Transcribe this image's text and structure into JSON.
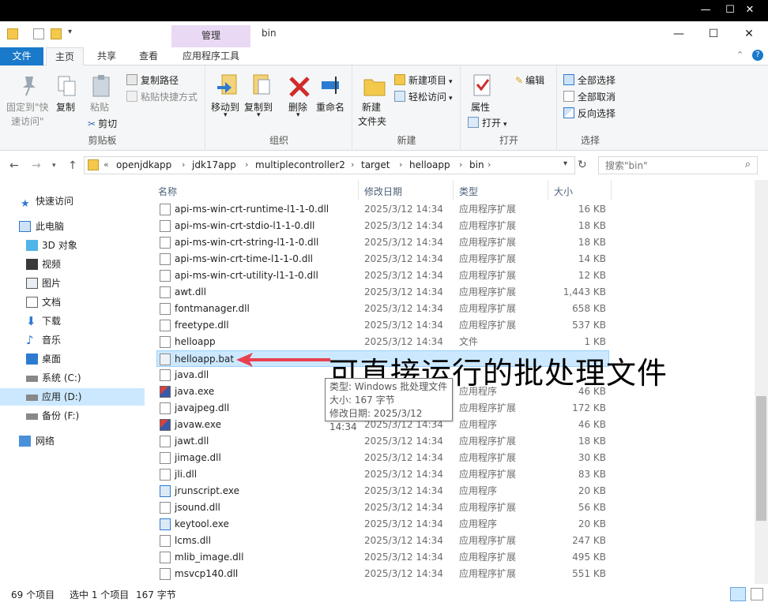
{
  "window": {
    "title": "bin",
    "contextual_group": "管理",
    "controls": {
      "minimize": "—",
      "maximize": "☐",
      "close": "✕"
    }
  },
  "tabs": {
    "file": "文件",
    "home": "主页",
    "share": "共享",
    "view": "查看",
    "app_tools": "应用程序工具"
  },
  "ribbon": {
    "clipboard": {
      "label": "剪贴板",
      "pin_l1": "固定到\"快",
      "pin_l2": "速访问\"",
      "copy": "复制",
      "paste": "粘贴",
      "copy_path": "复制路径",
      "paste_shortcut": "粘贴快捷方式",
      "cut": "剪切"
    },
    "organize": {
      "label": "组织",
      "move_to": "移动到",
      "copy_to": "复制到",
      "delete": "删除",
      "rename": "重命名"
    },
    "new": {
      "label": "新建",
      "new_folder_l1": "新建",
      "new_folder_l2": "文件夹",
      "new_item": "新建项目",
      "easy_access": "轻松访问"
    },
    "open": {
      "label": "打开",
      "properties": "属性",
      "open": "打开",
      "edit": "编辑"
    },
    "select": {
      "label": "选择",
      "select_all": "全部选择",
      "select_none": "全部取消",
      "invert": "反向选择"
    }
  },
  "address": {
    "crumbs": [
      "openjdkapp",
      "jdk17app",
      "multiplecontroller2",
      "target",
      "helloapp",
      "bin"
    ],
    "overflow": "«",
    "search_placeholder": "搜索\"bin\""
  },
  "nav": [
    {
      "label": "快速访问",
      "icon": "star-icon",
      "selected": false
    },
    {
      "label": "此电脑",
      "icon": "computer-icon",
      "selected": false
    },
    {
      "label": "3D 对象",
      "icon": "cube-icon",
      "selected": false
    },
    {
      "label": "视频",
      "icon": "video-icon",
      "selected": false
    },
    {
      "label": "图片",
      "icon": "picture-icon",
      "selected": false
    },
    {
      "label": "文档",
      "icon": "document-icon",
      "selected": false
    },
    {
      "label": "下载",
      "icon": "download-icon",
      "selected": false
    },
    {
      "label": "音乐",
      "icon": "music-icon",
      "selected": false
    },
    {
      "label": "桌面",
      "icon": "desktop-icon",
      "selected": false
    },
    {
      "label": "系统 (C:)",
      "icon": "drive-icon",
      "selected": false
    },
    {
      "label": "应用 (D:)",
      "icon": "drive-icon",
      "selected": true
    },
    {
      "label": "备份 (F:)",
      "icon": "drive-icon",
      "selected": false
    },
    {
      "label": "网络",
      "icon": "network-icon",
      "selected": false
    }
  ],
  "columns": {
    "name": "名称",
    "date": "修改日期",
    "type": "类型",
    "size": "大小"
  },
  "files": [
    {
      "name": "api-ms-win-crt-runtime-l1-1-0.dll",
      "date": "2025/3/12 14:34",
      "type": "应用程序扩展",
      "size": "16 KB",
      "icon": "dll"
    },
    {
      "name": "api-ms-win-crt-stdio-l1-1-0.dll",
      "date": "2025/3/12 14:34",
      "type": "应用程序扩展",
      "size": "18 KB",
      "icon": "dll"
    },
    {
      "name": "api-ms-win-crt-string-l1-1-0.dll",
      "date": "2025/3/12 14:34",
      "type": "应用程序扩展",
      "size": "18 KB",
      "icon": "dll"
    },
    {
      "name": "api-ms-win-crt-time-l1-1-0.dll",
      "date": "2025/3/12 14:34",
      "type": "应用程序扩展",
      "size": "14 KB",
      "icon": "dll"
    },
    {
      "name": "api-ms-win-crt-utility-l1-1-0.dll",
      "date": "2025/3/12 14:34",
      "type": "应用程序扩展",
      "size": "12 KB",
      "icon": "dll"
    },
    {
      "name": "awt.dll",
      "date": "2025/3/12 14:34",
      "type": "应用程序扩展",
      "size": "1,443 KB",
      "icon": "dll"
    },
    {
      "name": "fontmanager.dll",
      "date": "2025/3/12 14:34",
      "type": "应用程序扩展",
      "size": "658 KB",
      "icon": "dll"
    },
    {
      "name": "freetype.dll",
      "date": "2025/3/12 14:34",
      "type": "应用程序扩展",
      "size": "537 KB",
      "icon": "dll"
    },
    {
      "name": "helloapp",
      "date": "2025/3/12 14:34",
      "type": "文件",
      "size": "1 KB",
      "icon": "file"
    },
    {
      "name": "helloapp.bat",
      "date": "",
      "type": "",
      "size": "",
      "icon": "bat",
      "selected": true
    },
    {
      "name": "java.dll",
      "date": "",
      "type": "",
      "size": "",
      "icon": "dll"
    },
    {
      "name": "java.exe",
      "date": "",
      "type": "应用程序",
      "size": "46 KB",
      "icon": "exe-java"
    },
    {
      "name": "javajpeg.dll",
      "date": "",
      "type": "应用程序扩展",
      "size": "172 KB",
      "icon": "dll"
    },
    {
      "name": "javaw.exe",
      "date": "2025/3/12 14:34",
      "type": "应用程序",
      "size": "46 KB",
      "icon": "exe-java"
    },
    {
      "name": "jawt.dll",
      "date": "2025/3/12 14:34",
      "type": "应用程序扩展",
      "size": "18 KB",
      "icon": "dll"
    },
    {
      "name": "jimage.dll",
      "date": "2025/3/12 14:34",
      "type": "应用程序扩展",
      "size": "30 KB",
      "icon": "dll"
    },
    {
      "name": "jli.dll",
      "date": "2025/3/12 14:34",
      "type": "应用程序扩展",
      "size": "83 KB",
      "icon": "dll"
    },
    {
      "name": "jrunscript.exe",
      "date": "2025/3/12 14:34",
      "type": "应用程序",
      "size": "20 KB",
      "icon": "exe"
    },
    {
      "name": "jsound.dll",
      "date": "2025/3/12 14:34",
      "type": "应用程序扩展",
      "size": "56 KB",
      "icon": "dll"
    },
    {
      "name": "keytool.exe",
      "date": "2025/3/12 14:34",
      "type": "应用程序",
      "size": "20 KB",
      "icon": "exe"
    },
    {
      "name": "lcms.dll",
      "date": "2025/3/12 14:34",
      "type": "应用程序扩展",
      "size": "247 KB",
      "icon": "dll"
    },
    {
      "name": "mlib_image.dll",
      "date": "2025/3/12 14:34",
      "type": "应用程序扩展",
      "size": "495 KB",
      "icon": "dll"
    },
    {
      "name": "msvcp140.dll",
      "date": "2025/3/12 14:34",
      "type": "应用程序扩展",
      "size": "551 KB",
      "icon": "dll"
    }
  ],
  "tooltip": {
    "line1": "类型: Windows 批处理文件",
    "line2": "大小: 167 字节",
    "line3": "修改日期: 2025/3/12 14:34"
  },
  "annotation": "可直接运行的批处理文件",
  "status": {
    "count": "69 个项目",
    "selection": "选中 1 个项目",
    "size": "167 字节"
  },
  "colors": {
    "accent": "#1979ca",
    "selection": "#cce8ff",
    "context_tab": "#e9d9f4",
    "arrow": "#e8404f"
  }
}
